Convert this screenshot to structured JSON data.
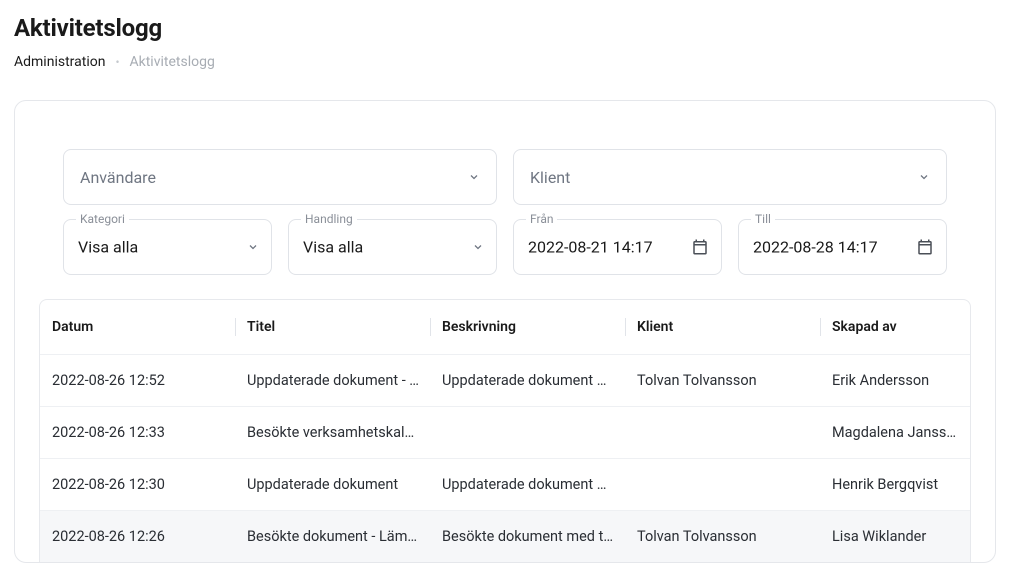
{
  "header": {
    "title": "Aktivitetslogg",
    "breadcrumb": {
      "first": "Administration",
      "current": "Aktivitetslogg"
    }
  },
  "filters": {
    "user": {
      "placeholder": "Användare"
    },
    "client": {
      "placeholder": "Klient"
    },
    "category": {
      "label": "Kategori",
      "value": "Visa alla"
    },
    "action": {
      "label": "Handling",
      "value": "Visa alla"
    },
    "from": {
      "label": "Från",
      "value": "2022-08-21 14:17"
    },
    "to": {
      "label": "Till",
      "value": "2022-08-28 14:17"
    }
  },
  "table": {
    "columns": {
      "date": "Datum",
      "title": "Titel",
      "description": "Beskrivning",
      "client": "Klient",
      "created_by": "Skapad av"
    },
    "rows": [
      {
        "date": "2022-08-26 12:52",
        "title": "Uppdaterade dokument - …",
        "description": "Uppdaterade dokument …",
        "client": "Tolvan Tolvansson",
        "created_by": "Erik Andersson"
      },
      {
        "date": "2022-08-26 12:33",
        "title": "Besökte verksamhetskal…",
        "description": "",
        "client": "",
        "created_by": "Magdalena Jansson"
      },
      {
        "date": "2022-08-26 12:30",
        "title": "Uppdaterade dokument",
        "description": "Uppdaterade dokument …",
        "client": "",
        "created_by": "Henrik Bergqvist"
      },
      {
        "date": "2022-08-26 12:26",
        "title": "Besökte dokument - Läm…",
        "description": "Besökte dokument med t…",
        "client": "Tolvan Tolvansson",
        "created_by": "Lisa Wiklander"
      }
    ]
  }
}
